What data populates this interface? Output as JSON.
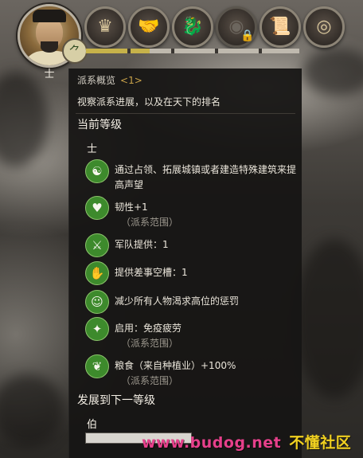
{
  "top_bar": {
    "rank_badge_glyph": "⺈",
    "rank_label": "士",
    "tabs": [
      {
        "icon": "advisors-icon",
        "glyph": "♛"
      },
      {
        "icon": "handshake-icon",
        "glyph": "🤝"
      },
      {
        "icon": "dragon-icon",
        "glyph": "🐉"
      },
      {
        "icon": "eye-icon",
        "glyph": "◉"
      },
      {
        "icon": "scroll-icon",
        "glyph": "📜"
      },
      {
        "icon": "coins-icon",
        "glyph": "◎"
      }
    ],
    "lock_glyph": "🔒",
    "progress_fraction": 0.3
  },
  "panel": {
    "title": "派系概览",
    "title_count": "<1>",
    "subtitle": "视察派系进展，以及在天下的排名",
    "current_level_header": "当前等级",
    "current_level": "士",
    "effects": [
      {
        "icon": "dragon-seal-icon",
        "glyph": "☯",
        "text": "通过占领、拓展城镇或者建造特殊建筑来提高声望",
        "scope": ""
      },
      {
        "icon": "heart-plus-icon",
        "glyph": "♥",
        "text": "韧性+1",
        "scope": "（派系范围）"
      },
      {
        "icon": "army-supply-icon",
        "glyph": "⚔",
        "text": "军队提供：1",
        "scope": ""
      },
      {
        "icon": "office-slot-icon",
        "glyph": "✋",
        "text": "提供差事空槽：1",
        "scope": ""
      },
      {
        "icon": "official-head-icon",
        "glyph": "☺",
        "text": "减少所有人物渴求高位的惩罚",
        "scope": ""
      },
      {
        "icon": "fatigue-immunity-icon",
        "glyph": "✦",
        "text": "启用：免疫疲劳",
        "scope": "（派系范围）"
      },
      {
        "icon": "grain-icon",
        "glyph": "❦",
        "text": "粮食（来自种植业）+100%",
        "scope": "（派系范围）"
      }
    ],
    "next_level_header": "发展到下一等级",
    "next_level": "伯",
    "next_level_progress_fraction": 0.0
  },
  "watermark": {
    "url": "www.budog.net",
    "site": "不懂社区"
  }
}
